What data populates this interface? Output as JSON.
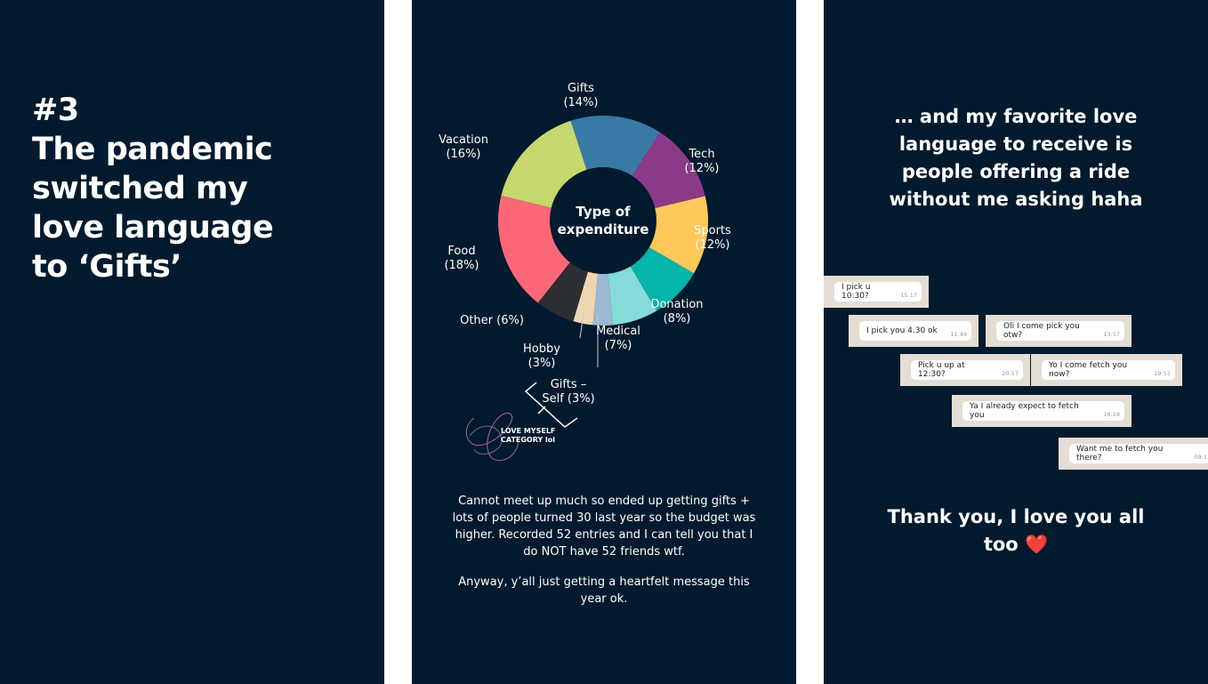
{
  "left_panel": {
    "headline": [
      "#3",
      "The pandemic",
      "switched my",
      "love language",
      "to ‘Gifts’"
    ]
  },
  "chart_data": {
    "type": "pie",
    "variant": "donut",
    "title": "Type of expenditure",
    "categories": [
      "Gifts",
      "Tech",
      "Sports",
      "Donation",
      "Medical",
      "Gifts - Self",
      "Hobby",
      "Other",
      "Food",
      "Vacation"
    ],
    "values": [
      14,
      12,
      12,
      8,
      7,
      3,
      3,
      6,
      18,
      16
    ],
    "unit": "%",
    "colors": [
      "#3a79a5",
      "#8b3a87",
      "#fec85a",
      "#05b5a9",
      "#84dbd7",
      "#9cb9d3",
      "#efd6b2",
      "#2b2e33",
      "#fe6777",
      "#c5d86e"
    ],
    "labels": [
      {
        "name": "Gifts",
        "pct": "(14%)"
      },
      {
        "name": "Tech",
        "pct": "(12%)"
      },
      {
        "name": "Sports",
        "pct": "(12%)"
      },
      {
        "name": "Donation",
        "pct": "(8%)"
      },
      {
        "name": "Medical",
        "pct": "(7%)"
      },
      {
        "name": "Gifts –",
        "pct": "Self (3%)"
      },
      {
        "name": "Hobby",
        "pct": "(3%)"
      },
      {
        "name": "Other (6%)",
        "pct": ""
      },
      {
        "name": "Food",
        "pct": "(18%)"
      },
      {
        "name": "Vacation",
        "pct": "(16%)"
      }
    ],
    "annotation": [
      "LOVE MYSELF",
      "CATEGORY lol"
    ]
  },
  "middle_panel": {
    "note1": "Cannot meet up much so ended up getting gifts + lots of people turned 30 last year so the budget was higher. Recorded 52 entries and I can tell you that I do NOT have 52 friends wtf.",
    "note2": "Anyway, y’all just getting a heartfelt message this year ok."
  },
  "right_panel": {
    "title": "… and my favorite love language to receive is people offering a ride without me asking haha",
    "messages": [
      {
        "text": "I pick u 10:30?",
        "time": "15:17"
      },
      {
        "text": "I pick you 4.30 ok",
        "time": "11:49"
      },
      {
        "text": "Oli I come pick you otw?",
        "time": "13:57"
      },
      {
        "text": "Pick u up at 12:30?",
        "time": "20:17"
      },
      {
        "text": "Yo I come fetch you now?",
        "time": "19:51"
      },
      {
        "text": "Ya I already expect to fetch you",
        "time": "16:18"
      },
      {
        "text": "Want me to fetch you there?",
        "time": "09:1"
      }
    ],
    "thanks": "Thank you, I love you all too ❤️"
  }
}
